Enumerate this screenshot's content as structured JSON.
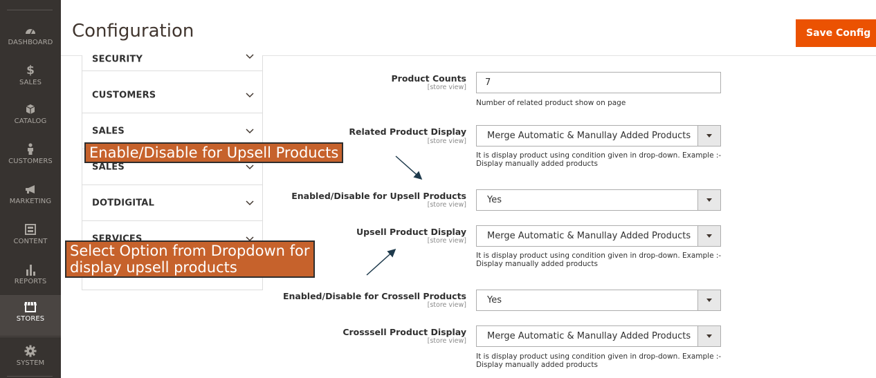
{
  "sidebar": {
    "items": [
      {
        "label": "DASHBOARD",
        "icon": "dashboard-gauge-icon"
      },
      {
        "label": "SALES",
        "icon": "dollar-icon"
      },
      {
        "label": "CATALOG",
        "icon": "cube-icon"
      },
      {
        "label": "CUSTOMERS",
        "icon": "person-icon"
      },
      {
        "label": "MARKETING",
        "icon": "megaphone-icon"
      },
      {
        "label": "CONTENT",
        "icon": "layout-icon"
      },
      {
        "label": "REPORTS",
        "icon": "bar-chart-icon"
      },
      {
        "label": "STORES",
        "icon": "storefront-icon",
        "active": true
      },
      {
        "label": "SYSTEM",
        "icon": "gear-icon"
      }
    ]
  },
  "header": {
    "title": "Configuration",
    "save_label": "Save Config"
  },
  "tabs": [
    "SECURITY",
    "CUSTOMERS",
    "SALES",
    "SALES",
    "DOTDIGITAL",
    "SERVICES"
  ],
  "form": {
    "scope_label": "[store view]",
    "product_counts": {
      "label": "Product Counts",
      "value": "7",
      "note": "Number of related product show on page"
    },
    "related_display": {
      "label": "Related Product Display",
      "value": "Merge Automatic & Manullay Added Products",
      "note": "It is display product using condition given in drop-down. Example :- Display manually added products"
    },
    "upsell_enabled": {
      "label": "Enabled/Disable for Upsell Products",
      "value": "Yes"
    },
    "upsell_display": {
      "label": "Upsell Product Display",
      "value": "Merge Automatic & Manullay Added Products",
      "note": "It is display product using condition given in drop-down. Example :- Display manually added products"
    },
    "crossell_enabled": {
      "label": "Enabled/Disable for Crossell Products",
      "value": "Yes"
    },
    "crossell_display": {
      "label": "Crosssell Product Display",
      "value": "Merge Automatic & Manullay Added Products",
      "note": "It is display product using condition given in drop-down. Example :- Display manually added products"
    }
  },
  "callouts": {
    "upsell_toggle": "Enable/Disable for Upsell Products",
    "upsell_dropdown_line1": "Select Option from Dropdown for",
    "upsell_dropdown_line2": "display upsell products"
  },
  "colors": {
    "sidebar_bg": "#373330",
    "accent": "#eb5202",
    "callout_bg": "#c6622c"
  }
}
